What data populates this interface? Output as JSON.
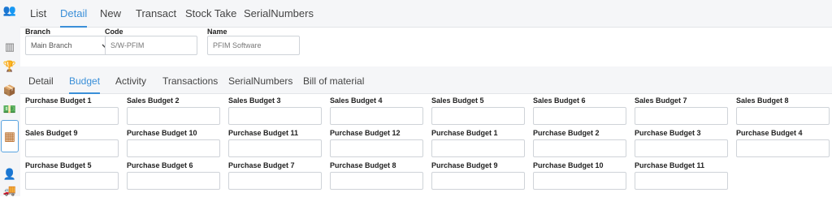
{
  "sidebar": {
    "icons": [
      "user-group-icon",
      "columns-icon",
      "trophy-icon",
      "box-icon",
      "money-icon",
      "inventory-icon",
      "delivery-icon",
      "truck-icon"
    ]
  },
  "top_tabs": [
    "List",
    "Detail",
    "New",
    "Transact",
    "Stock Take",
    "SerialNumbers"
  ],
  "top_active": "Detail",
  "header": {
    "branch_label": "Branch",
    "branch_value": "Main Branch",
    "code_label": "Code",
    "code_value": "S/W-PFIM",
    "name_label": "Name",
    "name_value": "PFIM Software"
  },
  "sub_tabs": [
    "Detail",
    "Budget",
    "Activity",
    "Transactions",
    "SerialNumbers",
    "Bill of material"
  ],
  "sub_active": "Budget",
  "budget_rows": [
    [
      "Purchase Budget 1",
      "Sales Budget 2",
      "Sales Budget 3",
      "Sales Budget 4",
      "Sales Budget 5",
      "Sales Budget 6",
      "Sales Budget 7",
      "Sales Budget 8"
    ],
    [
      "Sales Budget 9",
      "Purchase Budget 10",
      "Purchase Budget 11",
      "Purchase Budget 12",
      "Purchase Budget 1",
      "Purchase Budget 2",
      "Purchase Budget 3",
      "Purchase Budget 4"
    ],
    [
      "Purchase Budget 5",
      "Purchase Budget 6",
      "Purchase Budget 7",
      "Purchase Budget 8",
      "Purchase Budget 9",
      "Purchase Budget 10",
      "Purchase Budget 11"
    ]
  ]
}
